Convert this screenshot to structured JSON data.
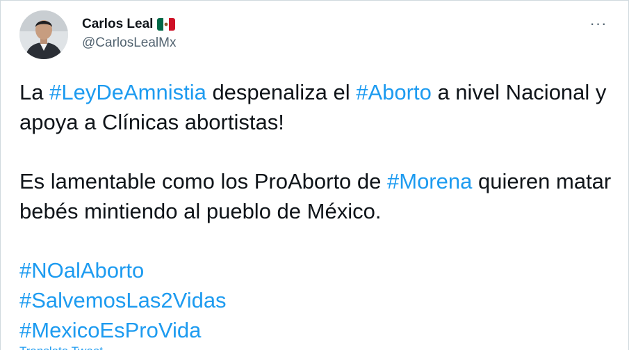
{
  "author": {
    "display_name": "Carlos Leal",
    "handle": "@CarlosLealMx",
    "flag_icon": "mexico-flag-icon",
    "avatar_icon": "profile-photo"
  },
  "more_icon": "more-options-icon",
  "more_label": "···",
  "tweet": {
    "p1": {
      "t1": "La ",
      "h1": "#LeyDeAmnistia",
      "t2": " despenaliza el ",
      "h2": "#Aborto",
      "t3": " a nivel Nacional y apoya a Clínicas abortistas!"
    },
    "p2": {
      "t1": "Es lamentable como los ProAborto de ",
      "h1": "#Morena",
      "t2": " quieren matar bebés mintiendo al pueblo de México."
    },
    "hashtags": [
      "#NOalAborto",
      "#SalvemosLas2Vidas",
      "#MexicoEsProVida"
    ]
  },
  "translate_label": "Translate Tweet",
  "colors": {
    "link": "#1d9bf0",
    "text": "#0f1419",
    "secondary": "#536471"
  }
}
